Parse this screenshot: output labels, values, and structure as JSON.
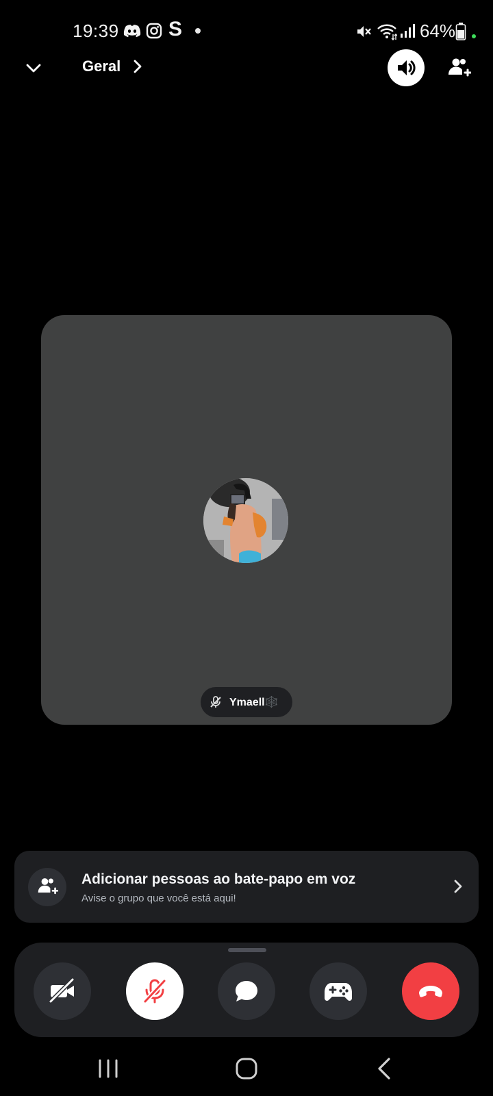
{
  "status_bar": {
    "time": "19:39",
    "notification_icons": [
      "discord-icon",
      "instagram-icon",
      "s-app-icon",
      "dot-icon"
    ],
    "s_glyph": "S",
    "right_icons": [
      "mute-icon",
      "wifi-icon",
      "signal-icon",
      "battery-icon"
    ],
    "battery": "64%"
  },
  "header": {
    "channel_name": "Geral"
  },
  "participant": {
    "name": "Ymaell🕸️",
    "muted": true
  },
  "invite_card": {
    "title": "Adicionar pessoas ao bate-papo em voz",
    "subtitle": "Avise o grupo que você está aqui!"
  },
  "controls": [
    {
      "name": "camera-off-button",
      "icon": "video-off-icon"
    },
    {
      "name": "mic-muted-button",
      "icon": "mic-off-icon"
    },
    {
      "name": "chat-button",
      "icon": "chat-bubble-icon"
    },
    {
      "name": "activities-button",
      "icon": "gamepad-icon"
    },
    {
      "name": "end-call-button",
      "icon": "phone-hangup-icon"
    }
  ],
  "colors": {
    "background": "#000000",
    "tile": "#404141",
    "panel": "#1e1f22",
    "button_dark": "#2e3035",
    "end_call": "#f23f43",
    "mute_red": "#f23f43"
  }
}
